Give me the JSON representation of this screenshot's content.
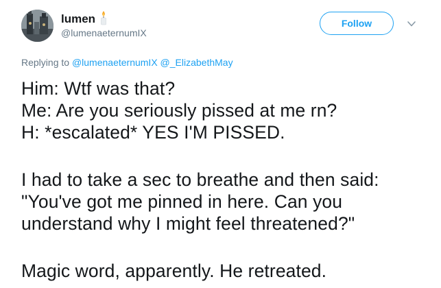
{
  "user": {
    "display_name": "lumen",
    "handle": "@lumenaeternumIX",
    "name_emoji": "candle-icon"
  },
  "actions": {
    "follow_label": "Follow",
    "menu_icon": "chevron-down-icon"
  },
  "reply": {
    "prefix": "Replying to",
    "mentions": [
      "@lumenaeternumIX",
      "@_ElizabethMay"
    ]
  },
  "tweet": {
    "lines": [
      "Him: Wtf was that?",
      "Me: Are you seriously pissed at me rn?",
      "H: *escalated* YES I'M PISSED.",
      "",
      "I had to take a sec to breathe and then said:",
      "\"You've got me pinned in here. Can you",
      "understand why I might feel threatened?\"",
      "",
      "Magic word, apparently. He retreated."
    ]
  },
  "colors": {
    "accent": "#1da1f2",
    "secondary_text": "#657786",
    "primary_text": "#14171a"
  }
}
